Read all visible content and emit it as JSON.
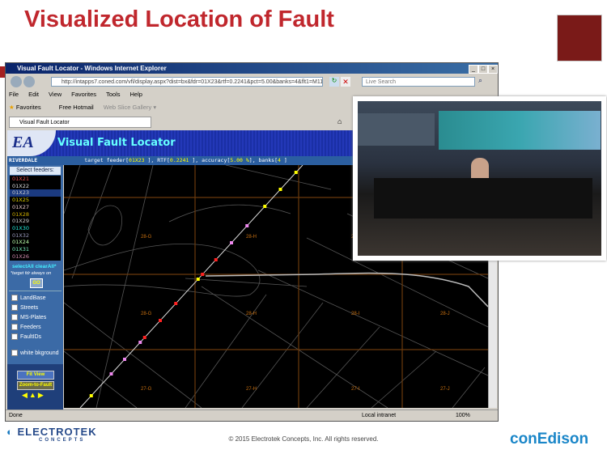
{
  "slide": {
    "title": "Visualized Location of Fault",
    "footer": "© 2015 Electrotek Concepts,  Inc. All rights reserved.",
    "logo_left": "ELECTROTEK",
    "logo_left_sub": "CONCEPTS",
    "logo_right": "conEdison"
  },
  "browser": {
    "window_title": "Visual Fault Locator - Windows Internet Explorer",
    "url": "http://intapps7.coned.com/vfl/display.aspx?dist=bx&fdr=01X23&rtf=0.2241&pct=5.00&banks=4&flt1=M1189",
    "search_placeholder": "Live Search",
    "menu": [
      "File",
      "Edit",
      "View",
      "Favorites",
      "Tools",
      "Help"
    ],
    "favorites": "Favorites",
    "fav_links": [
      "Free Hotmail",
      "Web Slice Gallery ▾"
    ],
    "tab": "Visual Fault Locator",
    "status_left": "Done",
    "zone": "Local intranet",
    "zoom": "100%"
  },
  "app": {
    "logo": "EA",
    "title": "Visual Fault Locator",
    "district": "RIVERDALE",
    "info": {
      "l1": "target feeder[",
      "feeder": "01X23 ",
      "l2": "], RTF[",
      "rtf": "0.2241 ",
      "l3": "], accuracy[",
      "acc": "5.00 %",
      "l4": "], banks[",
      "banks": "4 ",
      "l5": "]"
    },
    "select_feeders": "Select feeders:",
    "feeders": [
      {
        "name": "01X21",
        "color": "#e05050"
      },
      {
        "name": "01X22",
        "color": "#ddd"
      },
      {
        "name": "01X23",
        "color": "#ccc",
        "selected": true
      },
      {
        "name": "01X25",
        "color": "#e0d000"
      },
      {
        "name": "01X27",
        "color": "#e8c8c8"
      },
      {
        "name": "01X28",
        "color": "#d0b000"
      },
      {
        "name": "01X29",
        "color": "#ccc"
      },
      {
        "name": "01X30",
        "color": "#2ed"
      },
      {
        "name": "01X32",
        "color": "#99b"
      },
      {
        "name": "01X24",
        "color": "#bfa"
      },
      {
        "name": "01X31",
        "color": "#7eb"
      },
      {
        "name": "01X26",
        "color": "#c8a"
      }
    ],
    "select_all": "selectAll",
    "clear_all": "clearAll*",
    "note": "*target fdr always on",
    "go": "GO",
    "layers": [
      "LandBase",
      "Streets",
      "MS-Plates",
      "Feeders",
      "FaultIDs"
    ],
    "white_bg": "white bkground",
    "fit_view": "Fit View",
    "zoom_fault": "Zoom-to-Fault",
    "grid_labels": [
      "28-G",
      "28-H",
      "28-I",
      "28-J",
      "28-G",
      "28-H",
      "28-I",
      "28-J",
      "27-G",
      "27-H",
      "27-I",
      "27-J"
    ]
  }
}
